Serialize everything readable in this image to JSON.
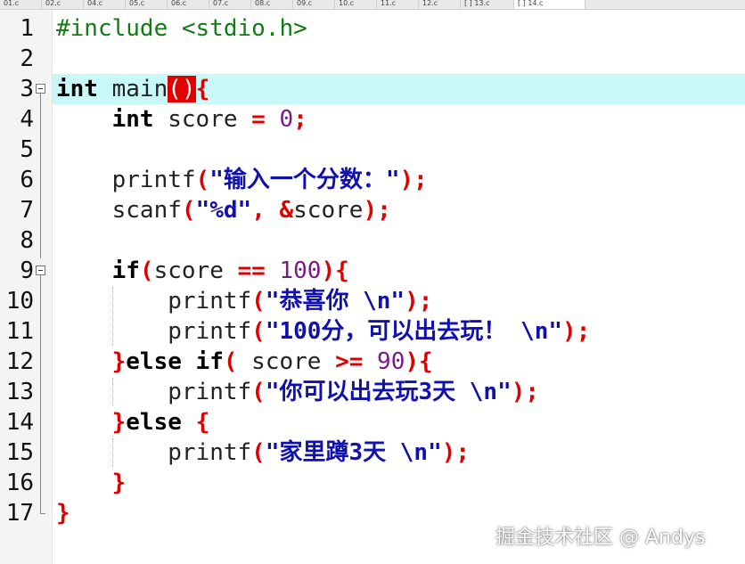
{
  "tabs": [
    "01.c",
    "02.c",
    "04.c",
    "05.c",
    "06.c",
    "07.c",
    "08.c",
    "09.c",
    "10.c",
    "11.c",
    "12.c",
    "[ ] 13.c",
    "[ ] 14.c"
  ],
  "line_numbers": [
    "1",
    "2",
    "3",
    "4",
    "5",
    "6",
    "7",
    "8",
    "9",
    "10",
    "11",
    "12",
    "13",
    "14",
    "15",
    "16",
    "17"
  ],
  "code": {
    "l1": "#include <stdio.h>",
    "l3_kw": "int",
    "l3_fn": " main",
    "l3_paren": "()",
    "l3_brace": "{",
    "l4_kw": "int",
    "l4_rest": " score ",
    "l4_eq": "=",
    "l4_num": " 0",
    "l4_semi": ";",
    "l6_fn": "printf",
    "l6_open": "(",
    "l6_str": "\"输入一个分数：\"",
    "l6_close": ");",
    "l7_fn": "scanf",
    "l7_open": "(",
    "l7_str": "\"%d\"",
    "l7_comma": ", &",
    "l7_var": "score",
    "l7_close": ");",
    "l9_kw": "if",
    "l9_open": "(",
    "l9_var": "score ",
    "l9_op": "==",
    "l9_num": " 100",
    "l9_close": "){",
    "l10_fn": "printf",
    "l10_open": "(",
    "l10_str": "\"恭喜你 \\n\"",
    "l10_close": ");",
    "l11_fn": "printf",
    "l11_open": "(",
    "l11_str": "\"100分，可以出去玩！ \\n\"",
    "l11_close": ");",
    "l12_br1": "}",
    "l12_kw": "else if",
    "l12_open": "(",
    "l12_var": " score ",
    "l12_op": ">=",
    "l12_num": " 90",
    "l12_close": "){",
    "l13_fn": "printf",
    "l13_open": "(",
    "l13_str": "\"你可以出去玩3天 \\n\"",
    "l13_close": ");",
    "l14_br1": "}",
    "l14_kw": "else ",
    "l14_br2": "{",
    "l15_fn": "printf",
    "l15_open": "(",
    "l15_str": "\"家里蹲3天 \\n\"",
    "l15_close": ");",
    "l16": "}",
    "l17": "}"
  },
  "watermark": "掘金技术社区 @ Andys",
  "colors": {
    "current_line": "#c8f8f8",
    "keyword": "#000000",
    "preprocessor": "#147a14",
    "string": "#1010b0",
    "number": "#7a1a8a",
    "brace": "#e00000"
  }
}
